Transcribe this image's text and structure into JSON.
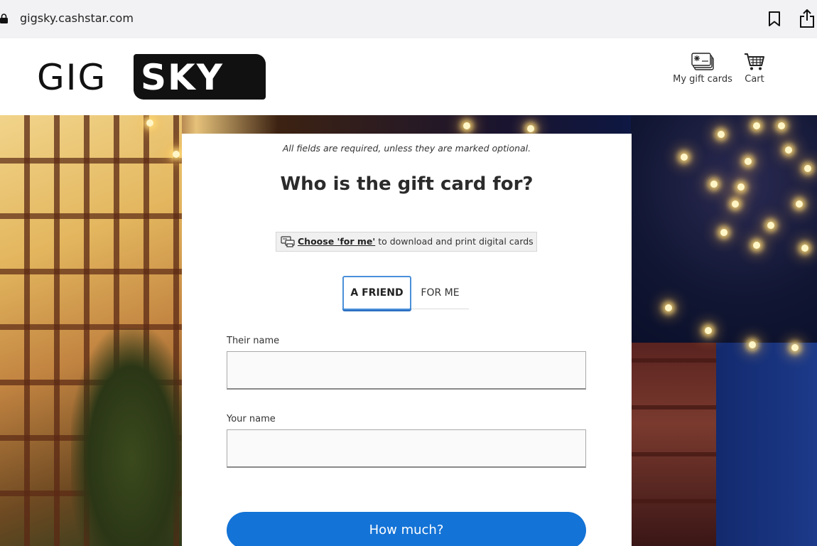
{
  "browser": {
    "url": "gigsky.cashstar.com"
  },
  "header": {
    "logo_left": "GIG",
    "logo_right": "SKY",
    "my_gift_cards_label": "My gift cards",
    "cart_label": "Cart"
  },
  "form": {
    "required_note": "All fields are required, unless they are marked optional.",
    "title": "Who is the gift card for?",
    "hint_strong": "Choose 'for me'",
    "hint_rest": " to download and print digital cards",
    "toggle": {
      "friend_label": "A FRIEND",
      "me_label": "FOR ME",
      "selected": "A FRIEND"
    },
    "their_name_label": "Their name",
    "their_name_value": "",
    "your_name_label": "Your name",
    "your_name_value": "",
    "submit_label": "How much?"
  },
  "colors": {
    "primary_button": "#1473d6",
    "toggle_border": "#4a8fd9",
    "logo_box": "#111111"
  }
}
